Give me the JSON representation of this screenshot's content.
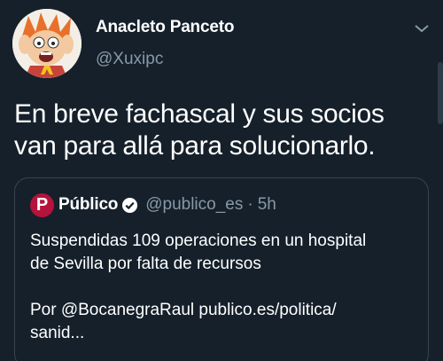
{
  "tweet": {
    "author_name": "Anacleto Panceto",
    "author_handle": "@Xuxipc",
    "text_line1": "En breve fachascal y sus socios",
    "text_line2": "van para allá para solucionarlo."
  },
  "quoted_tweet": {
    "logo_letter": "P",
    "author_name": "Público",
    "author_handle": "@publico_es",
    "separator": "·",
    "time": "5h",
    "text_line1": "Suspendidas 109 operaciones en un hospital",
    "text_line2": "de Sevilla por falta de recursos",
    "text_line3": "Por @BocanegraRaul publico.es/politica/",
    "text_line4": "sanid..."
  },
  "icons": {
    "menu": "chevron-down-icon",
    "verified": "verified-badge-icon",
    "avatar": "cartoon-avatar"
  },
  "colors": {
    "background": "#15202b",
    "secondary_text": "#8899a6",
    "border": "#38444d",
    "publico_brand": "#b5123c"
  }
}
